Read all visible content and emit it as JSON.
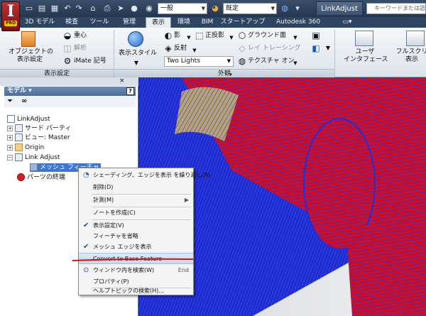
{
  "app": {
    "badge": "I",
    "pro_label": "PRO"
  },
  "quickaccess": {
    "style_combo": "一般",
    "material_combo": "既定"
  },
  "window": {
    "doc_title": "LinkAdjust",
    "search_placeholder": "キーワードまたは語"
  },
  "tabs": [
    "3D モデル",
    "検査",
    "ツール",
    "管理",
    "表示",
    "環境",
    "BIM",
    "スタートアップ",
    "Autodesk 360"
  ],
  "active_tab": "表示",
  "ribbon": {
    "object_display": "オブジェクトの\n表示設定",
    "center_of_gravity": "重心",
    "analysis": "解析",
    "imate_symbol": "iMate 記号",
    "group_display_settings": "表示設定",
    "display_style": "表示スタイル",
    "shadow": "影",
    "orthographic": "正投影",
    "ground_plane": "グラウンド面",
    "reflection": "反射",
    "ray_tracing": "レイ トレーシング",
    "lighting_style": "Two Lights",
    "texture_on": "テクスチャ オン",
    "group_appearance": "外観",
    "user_interface": "ユーザ\nインタフェース",
    "full_screen": "フルスクリ\n表示"
  },
  "browser": {
    "panel_title": "モデル",
    "help_label": "?",
    "tree": [
      {
        "label": "LinkAdjust",
        "level": 0
      },
      {
        "label": "サード パーティ",
        "level": 1
      },
      {
        "label": "ビュー: Master",
        "level": 1
      },
      {
        "label": "Origin",
        "level": 1
      },
      {
        "label": "Link Adjust",
        "level": 1
      },
      {
        "label": "メッシュ フィーチャ",
        "level": 2,
        "selected": true
      },
      {
        "label": "パーツの終端",
        "level": 1
      }
    ]
  },
  "context_menu": {
    "items": [
      {
        "label": "シェーディング、エッジを表示 を繰り返し",
        "key": "(R)"
      },
      {
        "label": "削除",
        "key": "(D)"
      },
      {
        "label": "計測",
        "key": "(M)",
        "arrow": "▶"
      },
      {
        "label": "ノートを作成",
        "key": "(C)"
      },
      {
        "label": "表示設定",
        "key": "(V)",
        "checked": true
      },
      {
        "label": "フィーチャを省略",
        "key": ""
      },
      {
        "label": "メッシュ エッジを表示",
        "key": "",
        "checked": true
      },
      {
        "label": "Convert to Base Feature",
        "key": "",
        "highlighted": true
      },
      {
        "label": "ウィンドウ内を検索",
        "key": "(W)",
        "shortcut": "End"
      },
      {
        "label": "プロパティ",
        "key": "(P)"
      },
      {
        "label": "ヘルプトピックの検索",
        "key": "(H)..."
      }
    ]
  },
  "colors": {
    "mesh_red": "#c8102e",
    "mesh_blue": "#1b2fe0",
    "mesh_tan": "#b9a372",
    "annotation_red": "#d41010",
    "highlight": "#c4d8f1"
  }
}
